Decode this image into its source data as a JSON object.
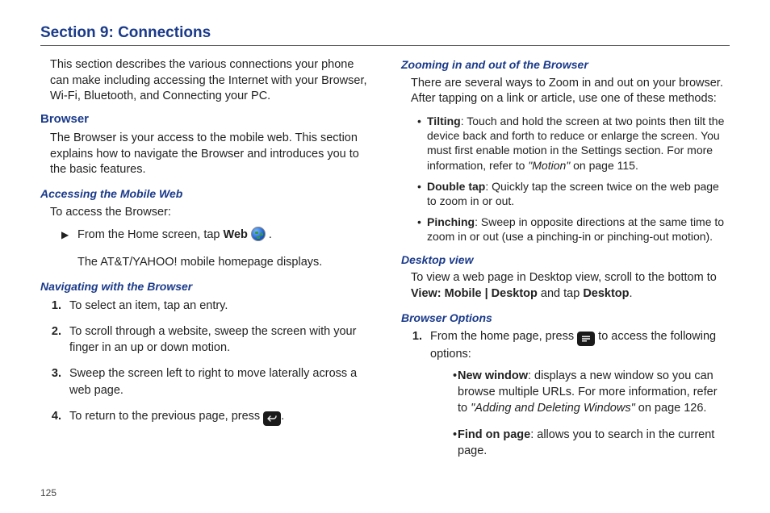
{
  "title": "Section 9: Connections",
  "page_number": "125",
  "left": {
    "intro": "This section describes the various connections your phone can make including accessing the Internet with your Browser, Wi-Fi, Bluetooth, and Connecting your PC.",
    "browser_heading": "Browser",
    "browser_intro": "The Browser is your access to the mobile web. This section explains how to navigate the Browser and introduces you to the basic features.",
    "accessing_heading": "Accessing the Mobile Web",
    "accessing_line": "To access the Browser:",
    "from_home_pre": "From the Home screen, tap ",
    "from_home_bold": "Web",
    "from_home_post": " .",
    "homepage_line": "The AT&T/YAHOO! mobile homepage displays.",
    "navigating_heading": "Navigating with the Browser",
    "nav_items": {
      "1": "To select an item, tap an entry.",
      "2": "To scroll through a website, sweep the screen with your finger in an up or down motion.",
      "3": "Sweep the screen left to right to move laterally across a web page.",
      "4_pre": "To return to the previous page, press ",
      "4_post": "."
    }
  },
  "right": {
    "zoom_heading": "Zooming in and out of the Browser",
    "zoom_intro": "There are several ways to Zoom in and out on your browser. After tapping on a link or article, use one of these methods:",
    "tilting_label": "Tilting",
    "tilting_text": ": Touch and hold the screen at two points then tilt the device back and forth to reduce or enlarge the screen. You must first enable motion in the Settings section. For more information, refer to ",
    "tilting_ref": "\"Motion\"",
    "tilting_page": " on page 115.",
    "doubletap_label": "Double tap",
    "doubletap_text": ": Quickly tap the screen twice on the web page to zoom in or out.",
    "pinching_label": "Pinching",
    "pinching_text": ": Sweep in opposite directions at the same time to zoom in or out (use a pinching-in or pinching-out motion).",
    "desktop_heading": "Desktop view",
    "desktop_pre": "To view a web page in Desktop view, scroll to the bottom to ",
    "desktop_bold1": "View: Mobile | Desktop",
    "desktop_mid": " and tap ",
    "desktop_bold2": "Desktop",
    "desktop_post": ".",
    "options_heading": "Browser Options",
    "opt1_pre": "From the home page, press ",
    "opt1_post": " to access the following options:",
    "newwindow_label": "New window",
    "newwindow_text": ": displays a new window so you can browse multiple URLs. For more information, refer to ",
    "newwindow_ref": "\"Adding and Deleting Windows\"",
    "newwindow_page": " on page 126.",
    "findonpage_label": "Find on page",
    "findonpage_text": ": allows you to search in the current page."
  }
}
